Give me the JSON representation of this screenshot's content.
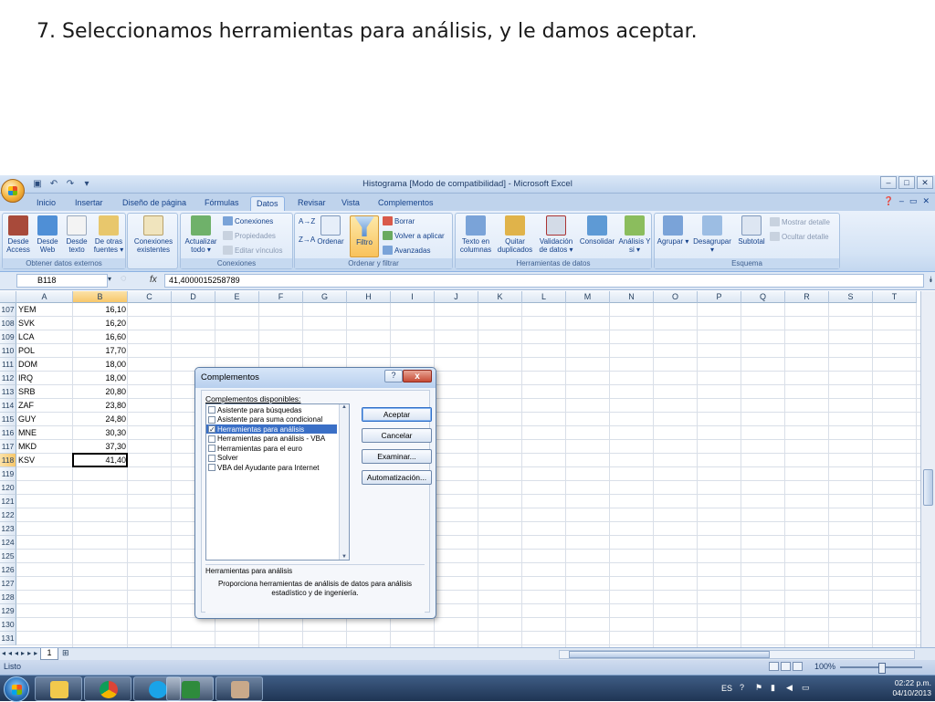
{
  "slide": {
    "title": "7. Seleccionamos herramientas para análisis, y le damos aceptar."
  },
  "window": {
    "title": "Histograma [Modo de compatibilidad] - Microsoft Excel"
  },
  "tabs": [
    "Inicio",
    "Insertar",
    "Diseño de página",
    "Fórmulas",
    "Datos",
    "Revisar",
    "Vista",
    "Complementos"
  ],
  "active_tab": "Datos",
  "ribbon": {
    "obtener": {
      "label": "Obtener datos externos",
      "buttons": [
        "Desde Access",
        "Desde Web",
        "Desde texto",
        "De otras fuentes ▾",
        "Conexiones existentes"
      ]
    },
    "conexiones": {
      "label": "Conexiones",
      "refresh": "Actualizar todo ▾",
      "conexiones": "Conexiones",
      "propiedades": "Propiedades",
      "editar": "Editar vínculos"
    },
    "ordenar": {
      "label": "Ordenar y filtrar",
      "az": "A→Z",
      "za": "Z→A",
      "ordenar": "Ordenar",
      "filtro": "Filtro",
      "borrar": "Borrar",
      "volver": "Volver a aplicar",
      "avanzadas": "Avanzadas"
    },
    "herramientas": {
      "label": "Herramientas de datos",
      "buttons": [
        "Texto en columnas",
        "Quitar duplicados",
        "Validación de datos ▾",
        "Consolidar",
        "Análisis Y si ▾"
      ]
    },
    "esquema": {
      "label": "Esquema",
      "buttons": [
        "Agrupar ▾",
        "Desagrupar ▾",
        "Subtotal"
      ],
      "mostrar": "Mostrar detalle",
      "ocultar": "Ocultar detalle"
    }
  },
  "formula_bar": {
    "namebox": "B118",
    "fx": "fx",
    "value": "41,4000015258789"
  },
  "columns": [
    "A",
    "B",
    "C",
    "D",
    "E",
    "F",
    "G",
    "H",
    "I",
    "J",
    "K",
    "L",
    "M",
    "N",
    "O",
    "P",
    "Q",
    "R",
    "S",
    "T"
  ],
  "rows": [
    {
      "n": "107",
      "a": "YEM",
      "b": "16,10"
    },
    {
      "n": "108",
      "a": "SVK",
      "b": "16,20"
    },
    {
      "n": "109",
      "a": "LCA",
      "b": "16,60"
    },
    {
      "n": "110",
      "a": "POL",
      "b": "17,70"
    },
    {
      "n": "111",
      "a": "DOM",
      "b": "18,00"
    },
    {
      "n": "112",
      "a": "IRQ",
      "b": "18,00"
    },
    {
      "n": "113",
      "a": "SRB",
      "b": "20,80"
    },
    {
      "n": "114",
      "a": "ZAF",
      "b": "23,80"
    },
    {
      "n": "115",
      "a": "GUY",
      "b": "24,80"
    },
    {
      "n": "116",
      "a": "MNE",
      "b": "30,30"
    },
    {
      "n": "117",
      "a": "MKD",
      "b": "37,30"
    },
    {
      "n": "118",
      "a": "KSV",
      "b": "41,40"
    },
    {
      "n": "119",
      "a": "",
      "b": ""
    },
    {
      "n": "120",
      "a": "",
      "b": ""
    },
    {
      "n": "121",
      "a": "",
      "b": ""
    },
    {
      "n": "122",
      "a": "",
      "b": ""
    },
    {
      "n": "123",
      "a": "",
      "b": ""
    },
    {
      "n": "124",
      "a": "",
      "b": ""
    },
    {
      "n": "125",
      "a": "",
      "b": ""
    },
    {
      "n": "126",
      "a": "",
      "b": ""
    },
    {
      "n": "127",
      "a": "",
      "b": ""
    },
    {
      "n": "128",
      "a": "",
      "b": ""
    },
    {
      "n": "129",
      "a": "",
      "b": ""
    },
    {
      "n": "130",
      "a": "",
      "b": ""
    },
    {
      "n": "131",
      "a": "",
      "b": ""
    }
  ],
  "sheet": {
    "tab": "1",
    "status": "Listo",
    "zoom": "100%"
  },
  "dialog": {
    "title": "Complementos",
    "help": "?",
    "close": "x",
    "available_label": "Complementos disponibles:",
    "addins": [
      {
        "label": "Asistente para búsquedas",
        "checked": false,
        "selected": false
      },
      {
        "label": "Asistente para suma condicional",
        "checked": false,
        "selected": false
      },
      {
        "label": "Herramientas para análisis",
        "checked": true,
        "selected": true
      },
      {
        "label": "Herramientas para análisis - VBA",
        "checked": false,
        "selected": false
      },
      {
        "label": "Herramientas para el euro",
        "checked": false,
        "selected": false
      },
      {
        "label": "Solver",
        "checked": false,
        "selected": false
      },
      {
        "label": "VBA del Ayudante para Internet",
        "checked": false,
        "selected": false
      }
    ],
    "buttons": {
      "accept": "Aceptar",
      "cancel": "Cancelar",
      "browse": "Examinar...",
      "automation": "Automatización..."
    },
    "desc_title": "Herramientas para análisis",
    "desc_text": "Proporciona herramientas de análisis de datos para análisis estadístico y de ingeniería."
  },
  "taskbar": {
    "lang": "ES",
    "time": "02:22 p.m.",
    "date": "04/10/2013"
  }
}
